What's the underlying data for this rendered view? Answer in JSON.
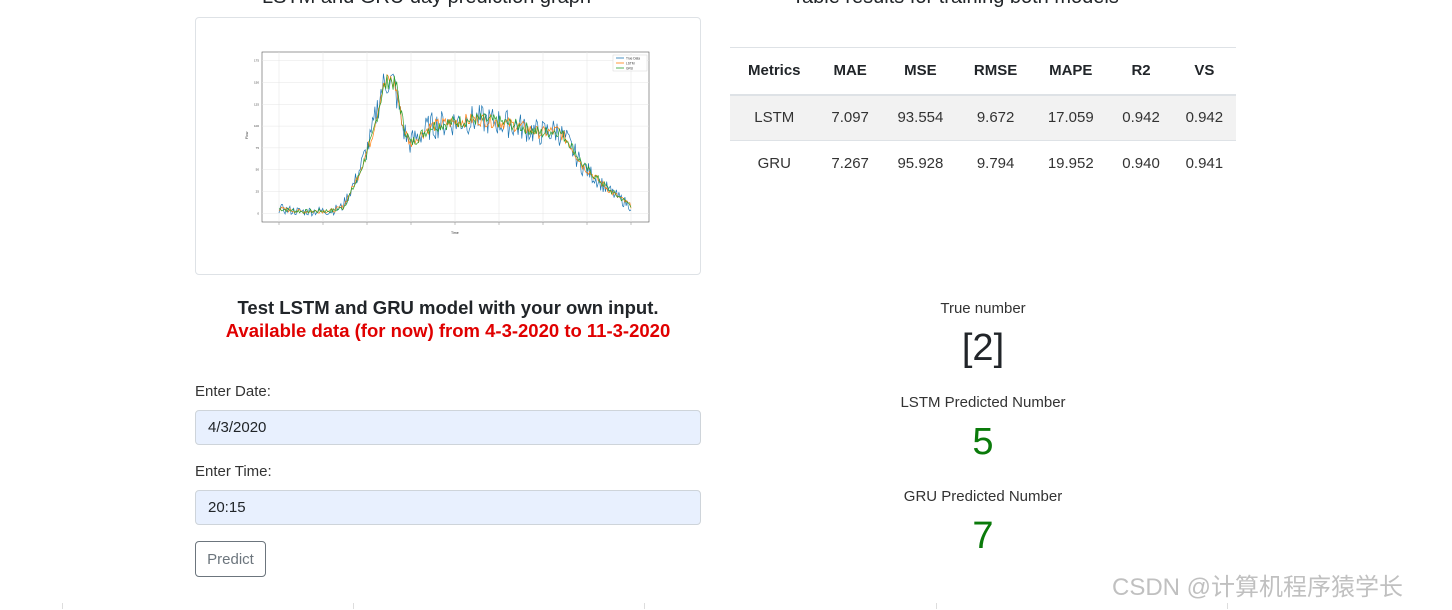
{
  "headings": {
    "graph": "LSTM and GRU day prediction graph",
    "table": "Table results for training both models"
  },
  "graph": {
    "legend": [
      "True Data",
      "LSTM",
      "GRU"
    ],
    "colors": {
      "true": "#1f77b4",
      "lstm": "#ff7f0e",
      "gru": "#2ca02c"
    },
    "ylabel": "Flow",
    "xlabel": "Time",
    "yticks": [
      "0",
      "25",
      "50",
      "75",
      "100",
      "125",
      "150",
      "175"
    ]
  },
  "metrics": {
    "headers": [
      "Metrics",
      "MAE",
      "MSE",
      "RMSE",
      "MAPE",
      "R2",
      "VS"
    ],
    "rows": [
      [
        "LSTM",
        "7.097",
        "93.554",
        "9.672",
        "17.059",
        "0.942",
        "0.942"
      ],
      [
        "GRU",
        "7.267",
        "95.928",
        "9.794",
        "19.952",
        "0.940",
        "0.941"
      ]
    ]
  },
  "test": {
    "title": "Test LSTM and GRU model with your own input.",
    "subtitle": "Available data (for now) from 4-3-2020 to 11-3-2020",
    "date_label": "Enter Date:",
    "date_value": "4/3/2020",
    "time_label": "Enter Time:",
    "time_value": "20:15",
    "predict_label": "Predict"
  },
  "results": {
    "true_label": "True number",
    "true_value": "[2]",
    "lstm_label": "LSTM Predicted Number",
    "lstm_value": "5",
    "gru_label": "GRU Predicted Number",
    "gru_value": "7"
  },
  "watermark": "CSDN @计算机程序猿学长"
}
